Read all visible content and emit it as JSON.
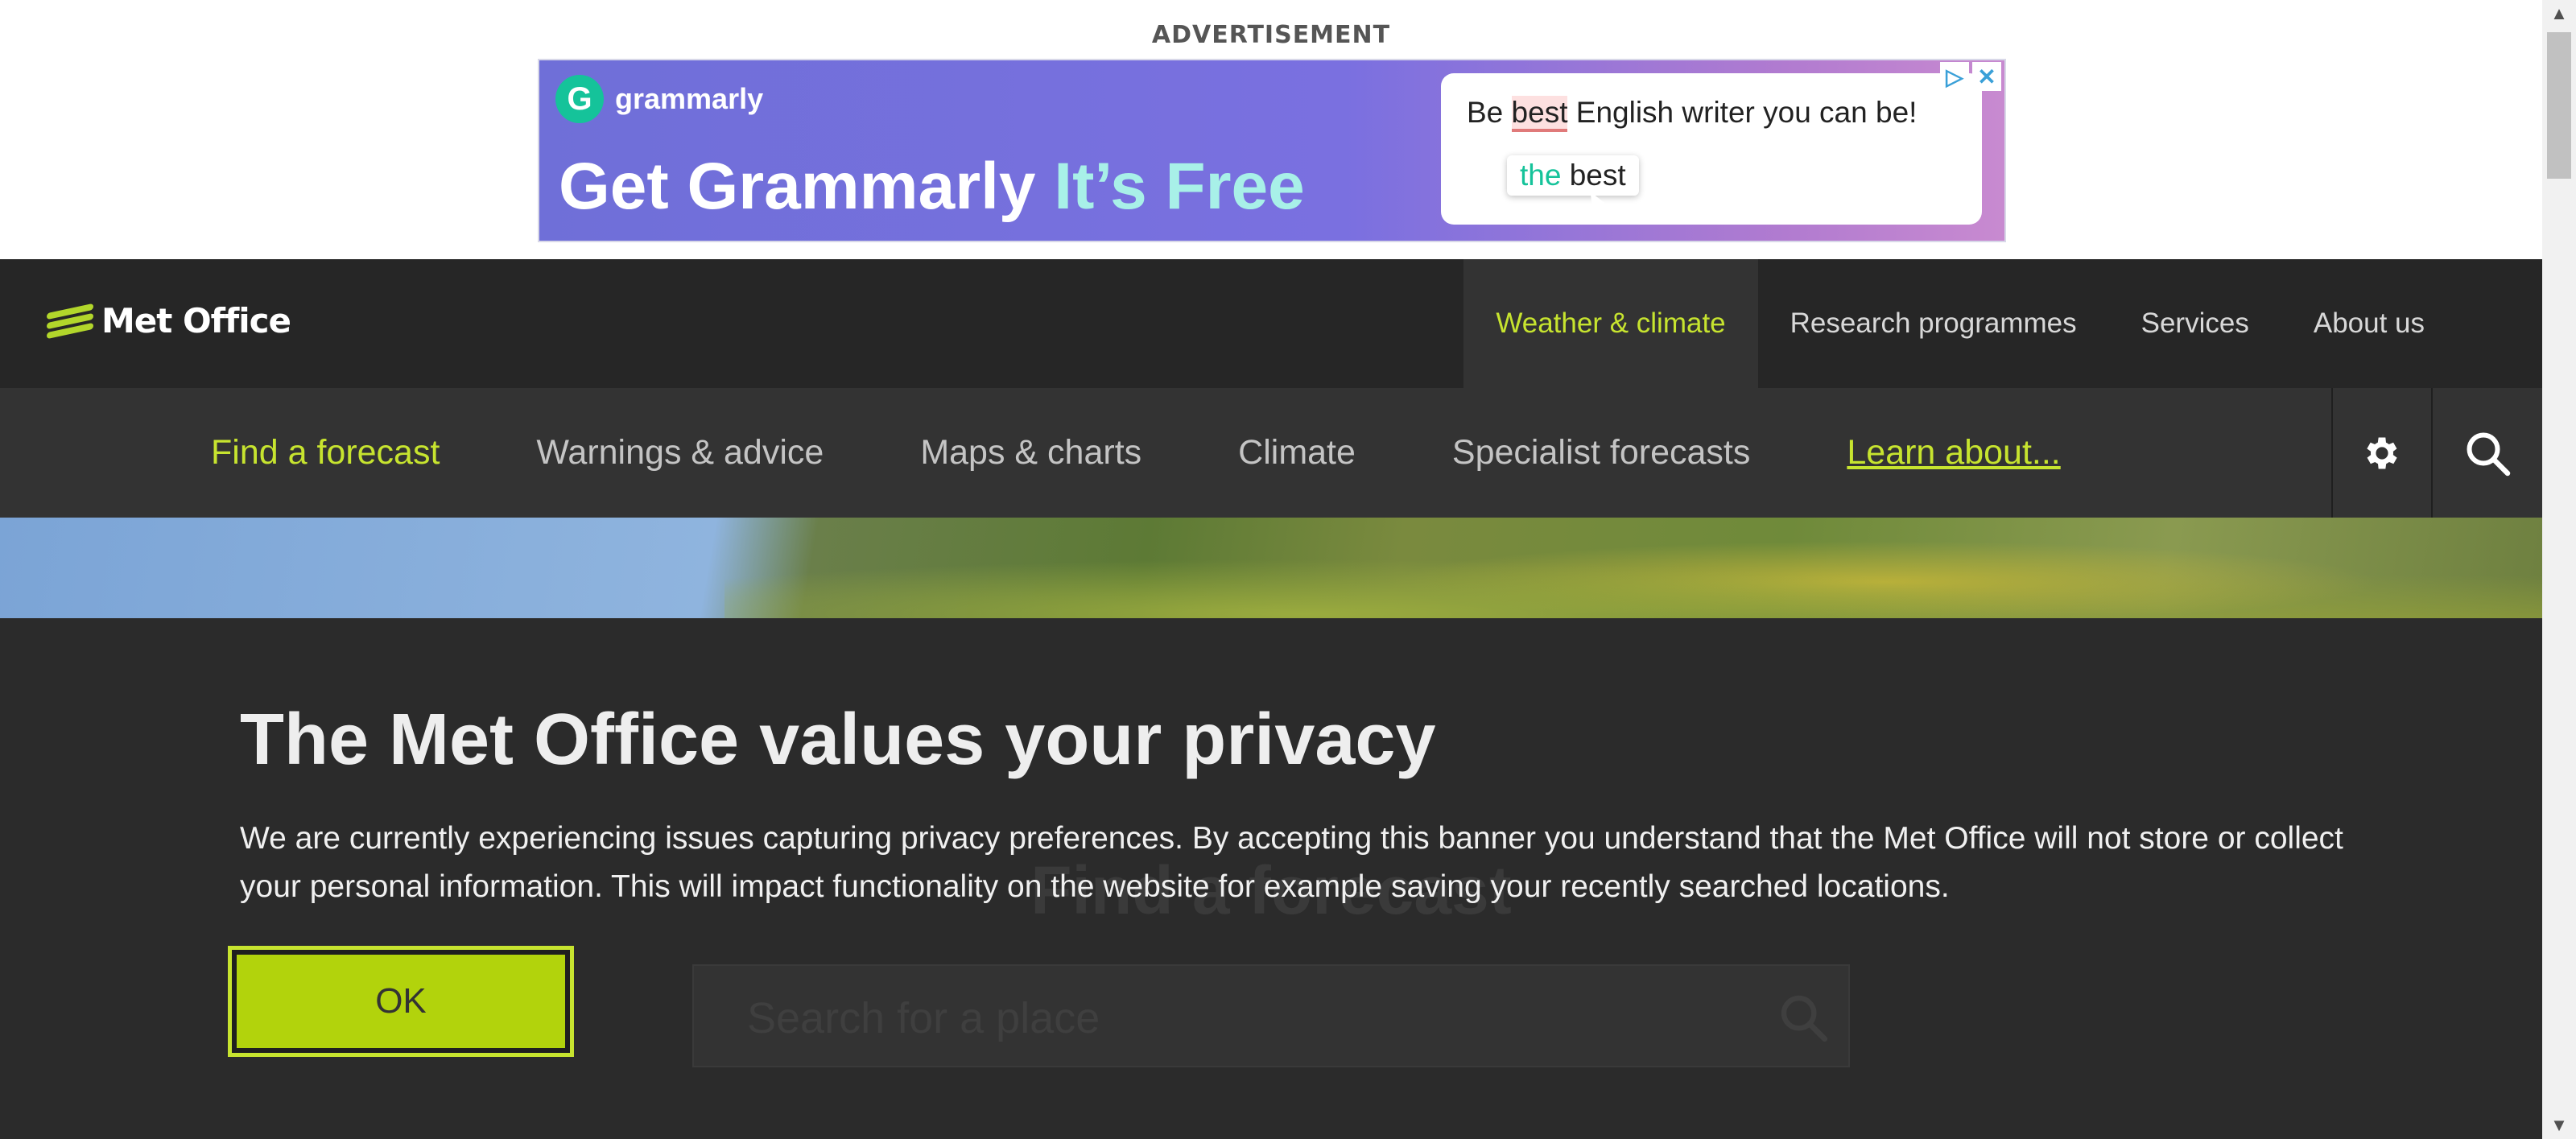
{
  "ad": {
    "label": "ADVERTISEMENT",
    "brand": "grammarly",
    "logo_letter": "G",
    "headline_main": "Get Grammarly",
    "headline_free": "It’s Free",
    "card_before": "Be ",
    "card_highlight": "best",
    "card_after": " English writer you can be!",
    "suggest_the": "the",
    "suggest_best": " best",
    "adchoices_icon": "adchoices-icon",
    "close_icon": "close-icon"
  },
  "header": {
    "logo_text": "Met Office",
    "top_nav": [
      {
        "label": "Weather & climate",
        "active": true
      },
      {
        "label": "Research programmes"
      },
      {
        "label": "Services"
      },
      {
        "label": "About us"
      }
    ]
  },
  "subnav": {
    "items": [
      {
        "label": "Find a forecast",
        "active": true
      },
      {
        "label": "Warnings & advice"
      },
      {
        "label": "Maps & charts"
      },
      {
        "label": "Climate"
      },
      {
        "label": "Specialist forecasts"
      },
      {
        "label": "Learn about..."
      }
    ],
    "settings_icon": "gear-icon",
    "search_icon": "search-icon"
  },
  "main": {
    "background_title": "Find a forecast",
    "search_placeholder": "Search for a place"
  },
  "privacy": {
    "title": "The Met Office values your privacy",
    "text": "We are currently experiencing issues capturing privacy preferences. By accepting this banner you understand that the Met Office will not store or collect your personal information. This will impact functionality on the website for example saving your recently searched locations.",
    "ok_label": "OK"
  },
  "colors": {
    "accent": "#c7e42f",
    "ok_button": "#b2d30c",
    "header_bg": "#262626",
    "subnav_bg": "#333333"
  }
}
